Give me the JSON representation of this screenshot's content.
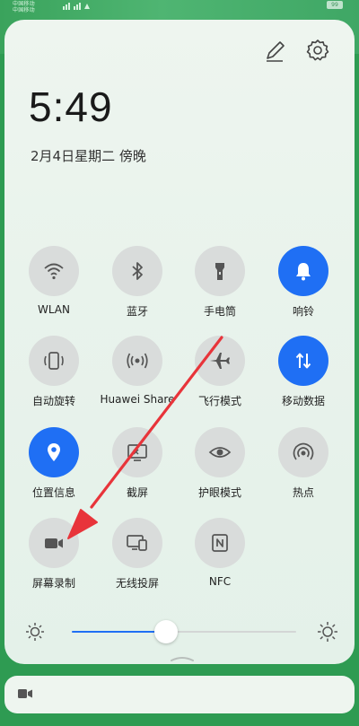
{
  "status_bar": {
    "carrier_1": "中国移动",
    "carrier_2": "中国移动",
    "battery": "99"
  },
  "header": {
    "time": "5:49",
    "date": "2月4日星期二 傍晚"
  },
  "tiles": [
    {
      "label": "WLAN",
      "icon": "wifi-icon",
      "on": false
    },
    {
      "label": "蓝牙",
      "icon": "bluetooth-icon",
      "on": false
    },
    {
      "label": "手电筒",
      "icon": "flashlight-icon",
      "on": false
    },
    {
      "label": "响铃",
      "icon": "bell-icon",
      "on": true
    },
    {
      "label": "自动旋转",
      "icon": "auto-rotate-icon",
      "on": false
    },
    {
      "label": "Huawei Share",
      "icon": "huawei-share-icon",
      "on": false
    },
    {
      "label": "飞行模式",
      "icon": "airplane-icon",
      "on": false
    },
    {
      "label": "移动数据",
      "icon": "mobile-data-icon",
      "on": true
    },
    {
      "label": "位置信息",
      "icon": "location-icon",
      "on": true
    },
    {
      "label": "截屏",
      "icon": "screenshot-icon",
      "on": false
    },
    {
      "label": "护眼模式",
      "icon": "eye-comfort-icon",
      "on": false
    },
    {
      "label": "热点",
      "icon": "hotspot-icon",
      "on": false
    },
    {
      "label": "屏幕录制",
      "icon": "screen-record-icon",
      "on": false
    },
    {
      "label": "无线投屏",
      "icon": "wireless-projection-icon",
      "on": false
    },
    {
      "label": "NFC",
      "icon": "nfc-icon",
      "on": false
    }
  ],
  "brightness": {
    "level": 0.42
  },
  "colors": {
    "accent": "#1f6ff4",
    "annotation_arrow": "#e8343a"
  }
}
